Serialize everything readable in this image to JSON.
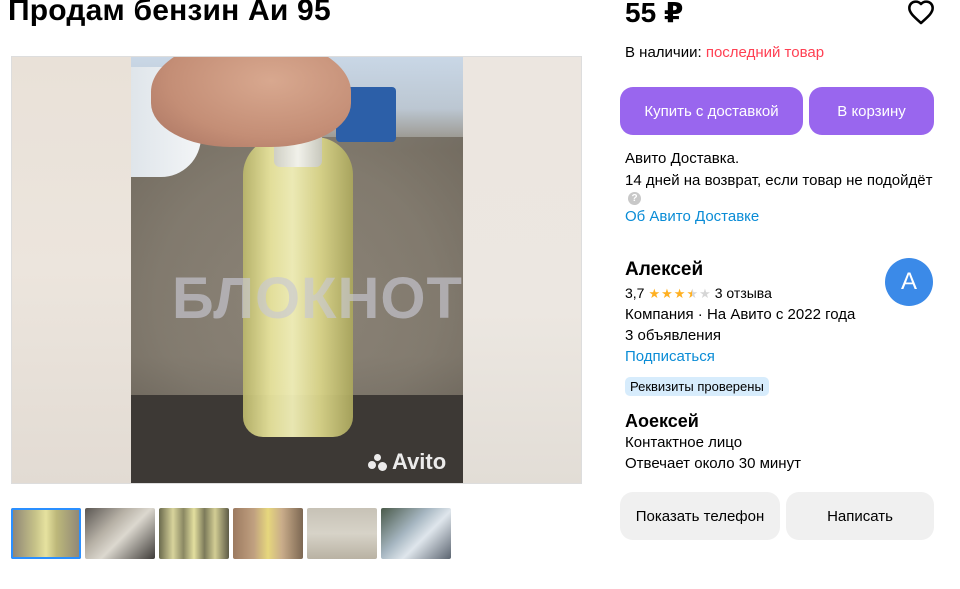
{
  "listing": {
    "title": "Продам бензин Аи 95",
    "price": "55 ₽",
    "availability_label": "В наличии: ",
    "availability_status": "последний товар"
  },
  "gallery": {
    "watermark_text": "БЛОКНОТ",
    "brand_mark": "Avito",
    "thumbnail_count": 6
  },
  "actions": {
    "buy_delivery": "Купить с доставкой",
    "add_to_cart": "В корзину",
    "show_phone": "Показать телефон",
    "write": "Написать"
  },
  "delivery": {
    "line1": "Авито Доставка.",
    "line2": "14 дней на возврат, если товар не подойдёт",
    "link": "Об Авито Доставке"
  },
  "seller": {
    "name": "Алексей",
    "rating": "3,7",
    "reviews": "3 отзыва",
    "company_line": "Компания · На Авито с 2022 года",
    "listings": "3 объявления",
    "subscribe": "Подписаться",
    "avatar_letter": "А",
    "verified_badge": "Реквизиты проверены"
  },
  "contact": {
    "name": "Аоексей",
    "role": "Контактное лицо",
    "response": "Отвечает около 30 минут"
  },
  "colors": {
    "accent_purple": "#9966ee",
    "warning_red": "#ff4053",
    "link_blue": "#0a8cd6",
    "avatar_blue": "#3b8ae8",
    "star_gold": "#ffb021"
  },
  "icons": {
    "favorite": "heart-icon",
    "info": "info-icon"
  }
}
